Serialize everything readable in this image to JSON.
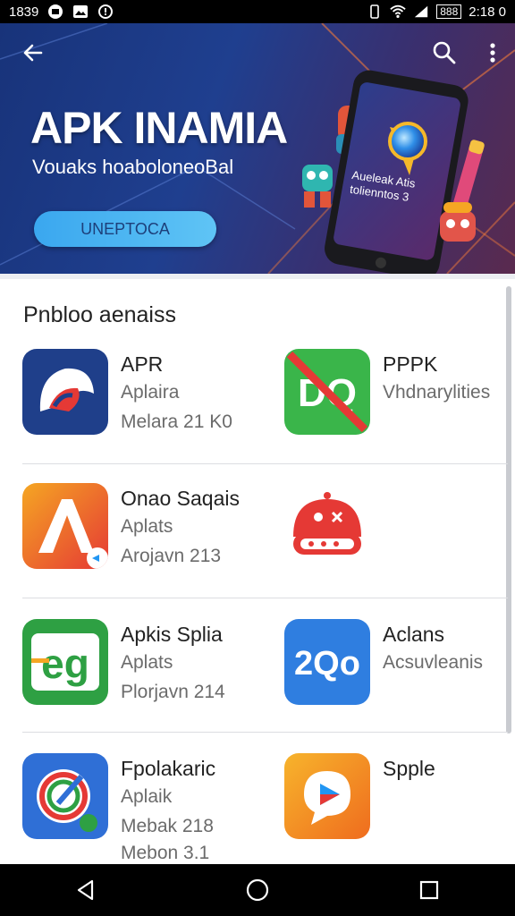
{
  "status_bar": {
    "time_left": "1839",
    "battery": "888",
    "time_right": "2:18 0"
  },
  "hero": {
    "title": "APK INAMIA",
    "subtitle": "Vouaks hoaboloneoBal",
    "button_label": "UNEPTOCA",
    "phone_caption": "Aueleak Atis tolienntos 3"
  },
  "section": {
    "title": "Pnbloo aenaiss"
  },
  "apps": [
    {
      "name": "APR",
      "line1": "Aplaira",
      "line2": "Melara 21 K0",
      "line3": "",
      "icon": "a-swirl-icon",
      "color": "#1e4aa8"
    },
    {
      "name": "PPPK",
      "line1": "Vhdnarylities",
      "line2": "",
      "line3": "",
      "icon": "green-dq-icon",
      "color": "#3ab54a"
    },
    {
      "name": "Onao Saqais",
      "line1": "Aplats",
      "line2": "Arojavn 213",
      "line3": "",
      "icon": "orange-a-icon",
      "color": "#f0622a"
    },
    {
      "name": "",
      "line1": "",
      "line2": "",
      "line3": "",
      "icon": "red-robot-icon",
      "color": "#e53935"
    },
    {
      "name": "Apkis Splia",
      "line1": "Aplats",
      "line2": "Plorjavn 214",
      "line3": "",
      "icon": "green-eg-icon",
      "color": "#2ea043"
    },
    {
      "name": "Aclans",
      "line1": "Acsuvleanis",
      "line2": "",
      "line3": "",
      "icon": "blue-2qo-icon",
      "color": "#2f7ee0"
    },
    {
      "name": "Fpolakaric",
      "line1": "Aplaik",
      "line2": "Mebak 218",
      "line3": "Mebon 3.1",
      "icon": "compass-icon",
      "color": "#2f6fd6"
    },
    {
      "name": "Spple",
      "line1": "",
      "line2": "",
      "line3": "",
      "icon": "orange-play-icon",
      "color": "#f39a1e"
    }
  ],
  "icon_texts": {
    "blue_2qo": "2Qo",
    "green_eg": "eg",
    "green_dq": "DQ"
  }
}
